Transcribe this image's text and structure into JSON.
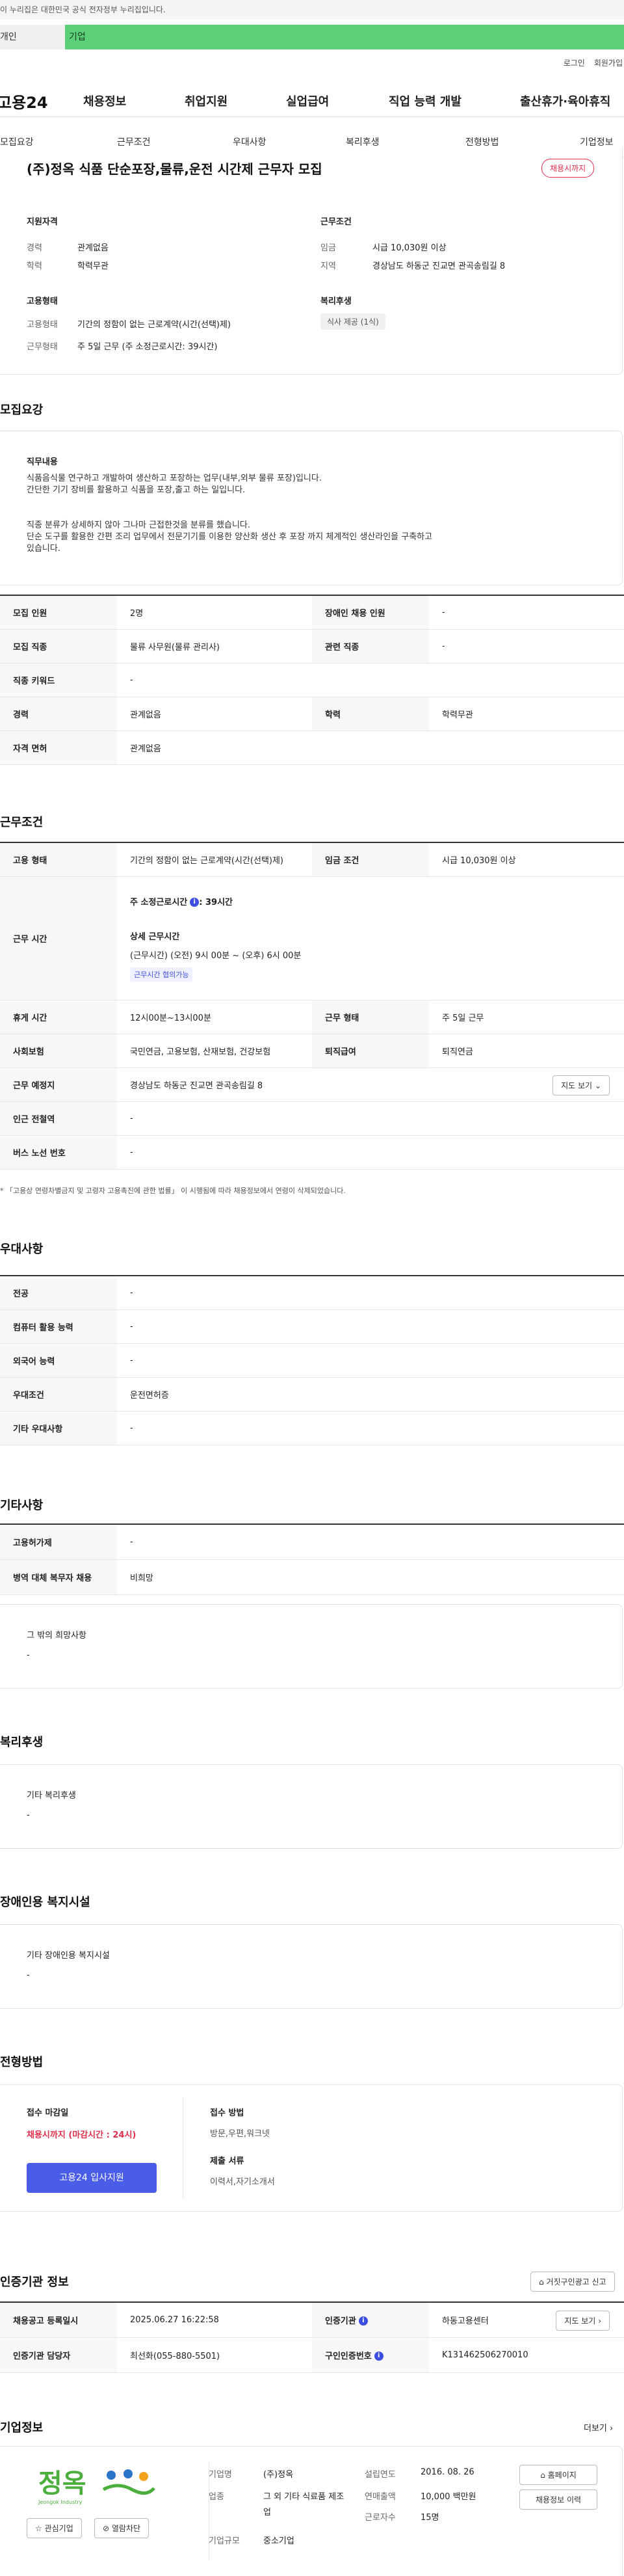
{
  "gov_banner": "이 누리집은 대한민국 공식 전자정부 누리집입니다.",
  "tabs": [
    "개인",
    "기업"
  ],
  "top_links": [
    "로그인",
    "회원가입"
  ],
  "gnb": {
    "logo": "고용24",
    "menu": [
      "채용정보",
      "취업지원",
      "실업급여",
      "직업 능력 개발",
      "출산휴가·육아휴직"
    ]
  },
  "lnb": [
    "모집요강",
    "근무조건",
    "우대사항",
    "복리후생",
    "전형방법",
    "기업정보"
  ],
  "summary": {
    "title": "(주)정옥 식품 단순포장,물류,운전 시간제 근무자 모집",
    "status": "채용시까지",
    "left_h1": "지원자격",
    "left_rows": [
      {
        "k": "경력",
        "v": "관계없음"
      },
      {
        "k": "학력",
        "v": "학력무관"
      }
    ],
    "left_h2": "고용형태",
    "left_rows2": [
      {
        "k": "고용형태",
        "v": "기간의 정함이 없는 근로계약(시간(선택)제)"
      },
      {
        "k": "근무형태",
        "v": "주 5일 근무 (주 소정근로시간: 39시간)"
      }
    ],
    "right_h1": "근무조건",
    "right_rows": [
      {
        "k": "임금",
        "v": "시급 10,030원 이상"
      },
      {
        "k": "지역",
        "v": "경상남도 하동군 진교면 관곡송림길 8"
      }
    ],
    "right_h2": "복리후생",
    "welfare_chip": "식사 제공 (1식)"
  },
  "recruit": {
    "heading": "모집요강",
    "duty_label": "직무내용",
    "duty_lines": [
      "식품음식물 연구하고 개발하여 생산하고 포장하는 업무(내부,외부 물류 포장)입니다.",
      "간단한 기기 장비를 활용하고 식품을 포장,출고 하는 일입니다.",
      "",
      "직종 분류가 상세하지 않아 그나마 근접한것을 분류를 했습니다.",
      "단순 도구를 활용한 간편 조리 업무에서 전문기기를 이용한 양산화 생산 후 포장 까지 체계적인 생산라인을 구축하고",
      "있습니다."
    ],
    "rows": [
      {
        "k": "모집 인원",
        "v": "2명",
        "k2": "장애인 채용 인원",
        "v2": "-"
      },
      {
        "k": "모집 직종",
        "v": "물류 사무원(물류 관리사)",
        "k2": "관련 직종",
        "v2": "-"
      },
      {
        "k": "직종 키워드",
        "v": "-"
      },
      {
        "k": "경력",
        "v": "관계없음",
        "k2": "학력",
        "v2": "학력무관"
      },
      {
        "k": "자격 면허",
        "v": "관계없음"
      }
    ]
  },
  "conditions": {
    "heading": "근무조건",
    "emp_type_k": "고용 형태",
    "emp_type_v": "기간의 정함이 없는 근로계약(시간(선택)제)",
    "wage_k": "임금 조건",
    "wage_v": "시급 10,030원 이상",
    "hours_k": "근무 시간",
    "weekly_hours_label": "주 소정근로시간",
    "weekly_hours_value": ": 39시간",
    "detail_label": "상세 근무시간",
    "detail_value": "(근무시간) (오전) 9시 00분 ~ (오후) 6시 00분",
    "chip": "근무시간 협의가능",
    "rest_k": "휴게 시간",
    "rest_v": "12시00분~13시00분",
    "form_k": "근무 형태",
    "form_v": "주 5일 근무",
    "ins_k": "사회보험",
    "ins_v": "국민연금, 고용보험, 산재보험, 건강보험",
    "pension_k": "퇴직급여",
    "pension_v": "퇴직연금",
    "place_k": "근무 예정지",
    "place_v": "경상남도 하동군 진교면 관곡송림길 8",
    "map_btn": "지도 보기",
    "subway_k": "인근 전철역",
    "subway_v": "-",
    "bus_k": "버스 노선 번호",
    "bus_v": "-",
    "note": "* 「고용상 연령차별금지 및 고령자 고용촉진에 관한 법률」 이 시행됨에 따라 채용정보에서 연령이 삭제되었습니다."
  },
  "preference": {
    "heading": "우대사항",
    "rows": [
      {
        "k": "전공",
        "v": "-"
      },
      {
        "k": "컴퓨터 활용 능력",
        "v": "-"
      },
      {
        "k": "외국어 능력",
        "v": "-"
      },
      {
        "k": "우대조건",
        "v": "운전면허증"
      },
      {
        "k": "기타 우대사항",
        "v": "-"
      }
    ]
  },
  "etc": {
    "heading": "기타사항",
    "rows": [
      {
        "k": "고용허가제",
        "v": "-"
      },
      {
        "k": "병역 대체 복무자 채용",
        "v": "비희망"
      }
    ],
    "other_label": "그 밖의 희망사항",
    "other_value": "-"
  },
  "welfare": {
    "heading": "복리후생",
    "label": "기타 복리후생",
    "value": "-"
  },
  "disabled": {
    "heading": "장애인용 복지시설",
    "label": "기타 장애인용 복지시설",
    "value": "-"
  },
  "selection": {
    "heading": "전형방법",
    "deadline_label": "접수 마감일",
    "deadline_value": "채용시까지 (마감시간 : 24시)",
    "apply_btn": "고용24 입사지원",
    "method_label": "접수 방법",
    "method_value": "방문,우편,워크넷",
    "docs_label": "제출 서류",
    "docs_value": "이력서,자기소개서"
  },
  "agency": {
    "heading": "인증기관 정보",
    "report_btn": "거짓구인광고 신고",
    "rows": [
      {
        "k": "채용공고 등록일시",
        "v": "2025.06.27 16:22:58",
        "k2": "인증기관",
        "v2": "하동고용센터",
        "btn": "지도 보기"
      },
      {
        "k": "인증기관 담당자",
        "v": "최선화(055-880-5501)",
        "k2": "구인인증번호",
        "v2": "K131462506270010"
      }
    ]
  },
  "company": {
    "heading": "기업정보",
    "more": "더보기",
    "logo_text": "정옥",
    "logo_sub": "Jeongok Industry",
    "interest_btn": "관심기업",
    "block_btn": "열람차단",
    "fields": [
      {
        "k": "기업명",
        "v": "(주)정옥"
      },
      {
        "k": "업종",
        "v": "그 외 기타 식료품 제조업"
      },
      {
        "k": "기업규모",
        "v": "중소기업"
      }
    ],
    "fields2": [
      {
        "k": "설립연도",
        "v": "2016. 08. 26"
      },
      {
        "k": "연매출액",
        "v": "10,000 백만원"
      },
      {
        "k": "근로자수",
        "v": "15명"
      }
    ],
    "homepage_btn": "홈페이지",
    "history_btn": "채용정보 이력"
  }
}
